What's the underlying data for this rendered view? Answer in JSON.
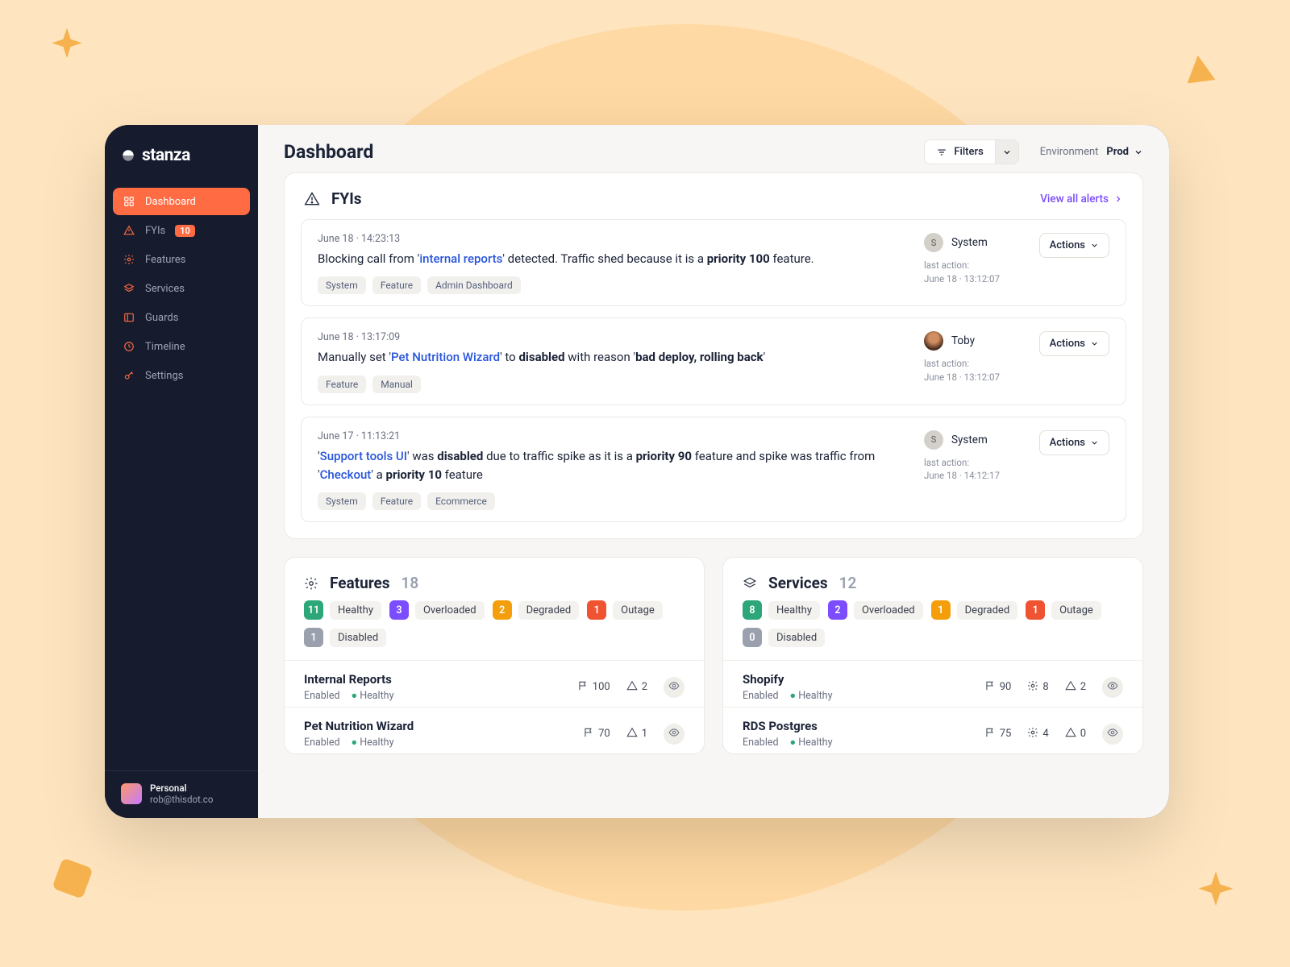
{
  "brand": "stanza",
  "sidebar": {
    "items": [
      {
        "label": "Dashboard",
        "icon": "grid",
        "active": true
      },
      {
        "label": "FYIs",
        "icon": "warning",
        "badge": "10"
      },
      {
        "label": "Features",
        "icon": "gear"
      },
      {
        "label": "Services",
        "icon": "layers"
      },
      {
        "label": "Guards",
        "icon": "panel"
      },
      {
        "label": "Timeline",
        "icon": "clock"
      },
      {
        "label": "Settings",
        "icon": "key"
      }
    ],
    "account": {
      "name": "Personal",
      "email": "rob@thisdot.co"
    }
  },
  "header": {
    "title": "Dashboard",
    "filters_label": "Filters",
    "env_label": "Environment",
    "env_value": "Prod"
  },
  "fyis": {
    "title": "FYIs",
    "view_all": "View all alerts",
    "actions_label": "Actions",
    "last_action_label": "last action:",
    "alerts": [
      {
        "date": "June 18",
        "time": "14:23:13",
        "text_html": "Blocking call from '<span class='hl-blue'>internal reports</span>' detected. Traffic shed because it is a <b>priority 100</b> feature.",
        "tags": [
          "System",
          "Feature",
          "Admin Dashboard"
        ],
        "actor": {
          "name": "System",
          "type": "system",
          "initial": "S"
        },
        "last_action": "June 18 · 13:12:07"
      },
      {
        "date": "June 18",
        "time": "13:17:09",
        "text_html": "Manually set '<span class='hl-blue'>Pet Nutrition Wizard</span>' to <b>disabled</b> with reason '<b>bad deploy, rolling back</b>'",
        "tags": [
          "Feature",
          "Manual"
        ],
        "actor": {
          "name": "Toby",
          "type": "photo"
        },
        "last_action": "June 18 · 13:12:07"
      },
      {
        "date": "June 17",
        "time": "11:13:21",
        "text_html": "'<span class='hl-blue'>Support tools UI</span>' was <b>disabled</b> due to traffic spike as it is a <b>priority 90</b> feature and spike was traffic from '<span class='hl-blue'>Checkout</span>' a <b>priority 10</b> feature",
        "tags": [
          "System",
          "Feature",
          "Ecommerce"
        ],
        "actor": {
          "name": "System",
          "type": "system",
          "initial": "S"
        },
        "last_action": "June 18 · 14:12:17"
      }
    ]
  },
  "features": {
    "title": "Features",
    "count": "18",
    "statuses": [
      {
        "n": "11",
        "label": "Healthy",
        "color": "green"
      },
      {
        "n": "3",
        "label": "Overloaded",
        "color": "purple"
      },
      {
        "n": "2",
        "label": "Degraded",
        "color": "orange"
      },
      {
        "n": "1",
        "label": "Outage",
        "color": "red"
      },
      {
        "n": "1",
        "label": "Disabled",
        "color": "grey"
      }
    ],
    "items": [
      {
        "name": "Internal Reports",
        "state": "Enabled",
        "health": "Healthy",
        "flag": "100",
        "warn": "2"
      },
      {
        "name": "Pet Nutrition Wizard",
        "state": "Enabled",
        "health": "Healthy",
        "flag": "70",
        "warn": "1"
      }
    ]
  },
  "services": {
    "title": "Services",
    "count": "12",
    "statuses": [
      {
        "n": "8",
        "label": "Healthy",
        "color": "green"
      },
      {
        "n": "2",
        "label": "Overloaded",
        "color": "purple"
      },
      {
        "n": "1",
        "label": "Degraded",
        "color": "orange"
      },
      {
        "n": "1",
        "label": "Outage",
        "color": "red"
      },
      {
        "n": "0",
        "label": "Disabled",
        "color": "grey"
      }
    ],
    "items": [
      {
        "name": "Shopify",
        "state": "Enabled",
        "health": "Healthy",
        "flag": "90",
        "gear": "8",
        "warn": "2"
      },
      {
        "name": "RDS Postgres",
        "state": "Enabled",
        "health": "Healthy",
        "flag": "75",
        "gear": "4",
        "warn": "0"
      }
    ]
  }
}
